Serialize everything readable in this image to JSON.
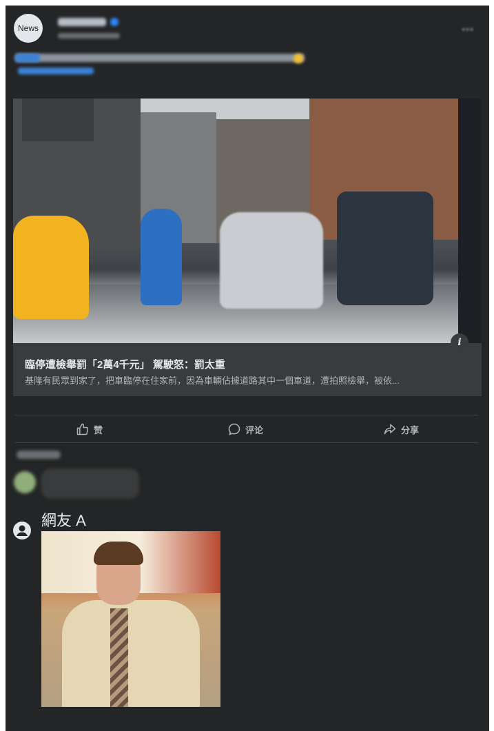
{
  "post": {
    "avatar_text": "News",
    "author_blurred": "",
    "more_icon": "more-dots-icon"
  },
  "link_card": {
    "title": "臨停遭檢舉罰「2萬4千元」 駕駛怒：罰太重",
    "description": "基隆有民眾到家了，把車臨停在住家前，因為車輛佔據道路其中一個車道，遭拍照檢舉，被依...",
    "info_icon_text": "i"
  },
  "actions": {
    "like_label": "赞",
    "comment_label": "评论",
    "share_label": "分享"
  },
  "comment": {
    "user_name": "網友 A"
  },
  "colors": {
    "background": "#242526",
    "link_box": "#3a3b3c",
    "text_primary": "#e4e6eb",
    "text_secondary": "#b0b3b8"
  }
}
